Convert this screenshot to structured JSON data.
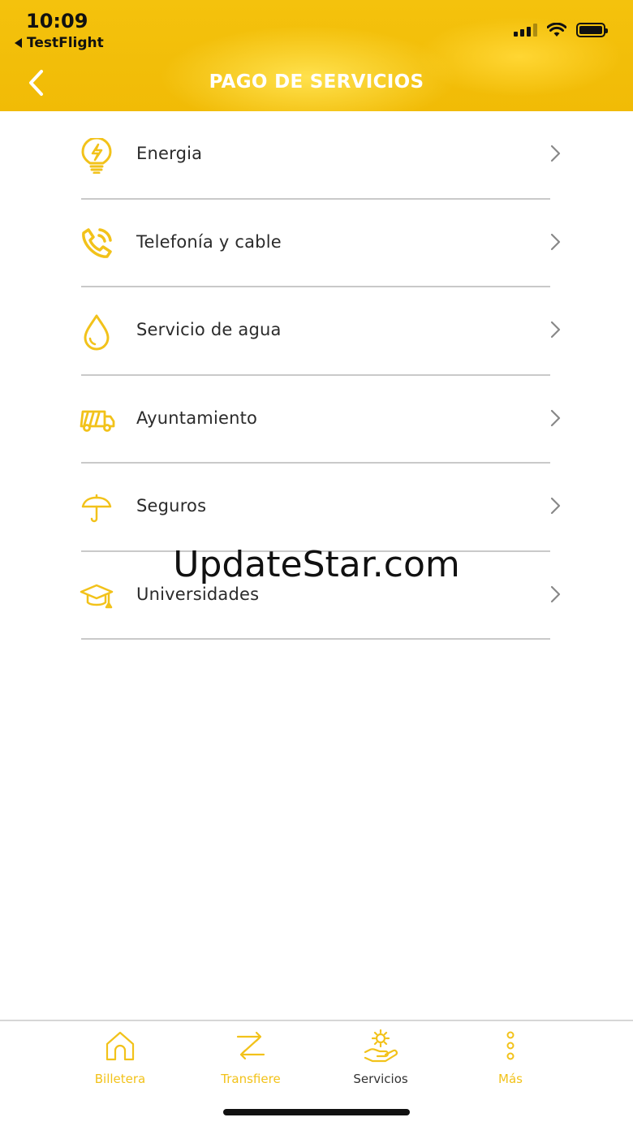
{
  "status_bar": {
    "time": "10:09",
    "back_app": "TestFlight",
    "icons": [
      "signal-icon",
      "wifi-icon",
      "battery-icon"
    ]
  },
  "nav": {
    "title": "PAGO DE SERVICIOS",
    "back_icon": "chevron-left-icon"
  },
  "services": [
    {
      "label": "Energia",
      "icon": "lightbulb-icon"
    },
    {
      "label": "Telefonía y cable",
      "icon": "phone-icon"
    },
    {
      "label": "Servicio de agua",
      "icon": "water-drop-icon"
    },
    {
      "label": "Ayuntamiento",
      "icon": "truck-icon"
    },
    {
      "label": "Seguros",
      "icon": "umbrella-icon"
    },
    {
      "label": "Universidades",
      "icon": "graduation-cap-icon"
    }
  ],
  "watermark": "UpdateStar.com",
  "tabbar": {
    "tabs": [
      {
        "label": "Billetera",
        "icon": "home-icon",
        "active": false
      },
      {
        "label": "Transfiere",
        "icon": "transfer-icon",
        "active": false
      },
      {
        "label": "Servicios",
        "icon": "services-hand-gear-icon",
        "active": true
      },
      {
        "label": "Más",
        "icon": "more-dots-icon",
        "active": false
      }
    ]
  },
  "colors": {
    "brand_yellow": "#f4c20d",
    "icon_yellow": "#f2c21a",
    "text_dark": "#2b2b2b",
    "divider": "#c9c9c9"
  }
}
